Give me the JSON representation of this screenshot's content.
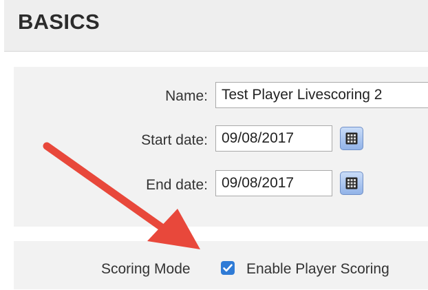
{
  "section": {
    "title": "BASICS"
  },
  "form": {
    "name": {
      "label": "Name:",
      "value": "Test Player Livescoring 2"
    },
    "start_date": {
      "label": "Start date:",
      "value": "09/08/2017"
    },
    "end_date": {
      "label": "End date:",
      "value": "09/08/2017"
    },
    "calendar_icon": "calendar-icon"
  },
  "scoring": {
    "label": "Scoring Mode",
    "checkbox_label": "Enable Player Scoring",
    "checked": true
  },
  "annotation": {
    "arrow_color": "#e8483b",
    "icon": "arrow-pointer"
  }
}
